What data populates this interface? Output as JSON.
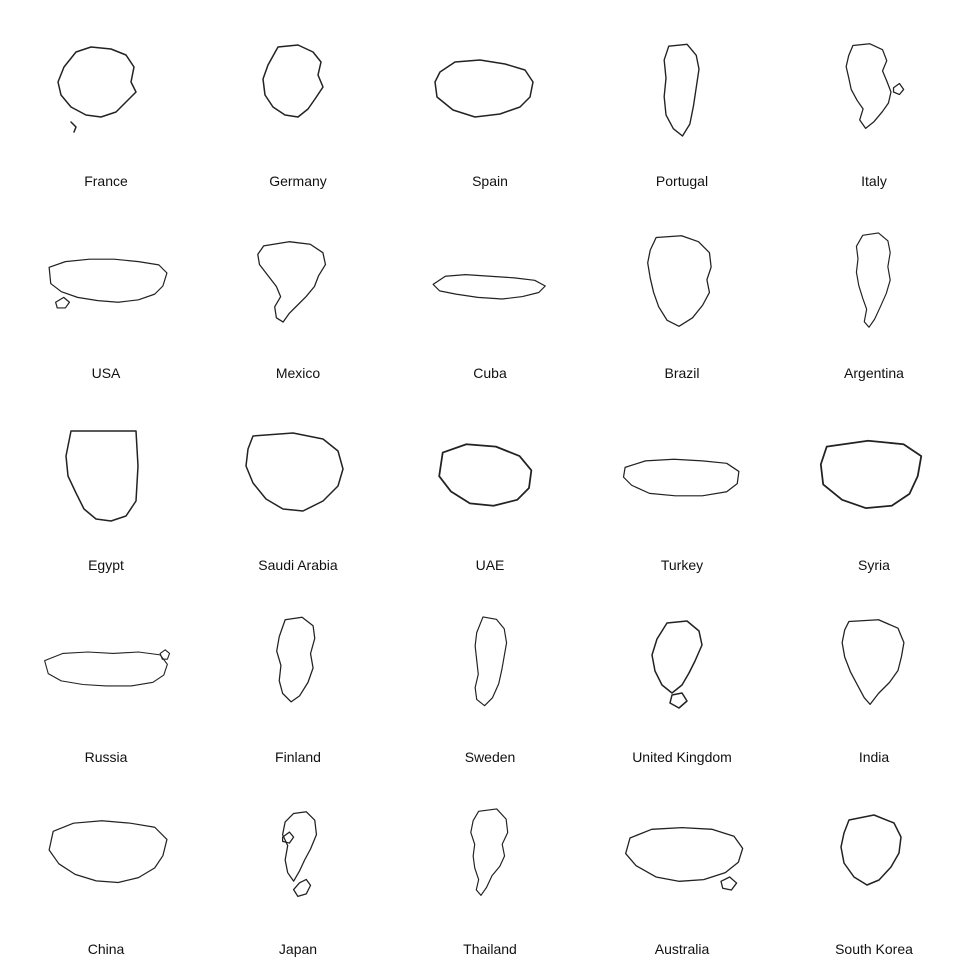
{
  "countries": [
    {
      "name": "France",
      "row": 1,
      "col": 1
    },
    {
      "name": "Germany",
      "row": 1,
      "col": 2
    },
    {
      "name": "Spain",
      "row": 1,
      "col": 3
    },
    {
      "name": "Portugal",
      "row": 1,
      "col": 4
    },
    {
      "name": "Italy",
      "row": 1,
      "col": 5
    },
    {
      "name": "USA",
      "row": 2,
      "col": 1
    },
    {
      "name": "Mexico",
      "row": 2,
      "col": 2
    },
    {
      "name": "Cuba",
      "row": 2,
      "col": 3
    },
    {
      "name": "Brazil",
      "row": 2,
      "col": 4
    },
    {
      "name": "Argentina",
      "row": 2,
      "col": 5
    },
    {
      "name": "Egypt",
      "row": 3,
      "col": 1
    },
    {
      "name": "Saudi Arabia",
      "row": 3,
      "col": 2
    },
    {
      "name": "UAE",
      "row": 3,
      "col": 3
    },
    {
      "name": "Turkey",
      "row": 3,
      "col": 4
    },
    {
      "name": "Syria",
      "row": 3,
      "col": 5
    },
    {
      "name": "Russia",
      "row": 4,
      "col": 1
    },
    {
      "name": "Finland",
      "row": 4,
      "col": 2
    },
    {
      "name": "Sweden",
      "row": 4,
      "col": 3
    },
    {
      "name": "United Kingdom",
      "row": 4,
      "col": 4
    },
    {
      "name": "India",
      "row": 4,
      "col": 5
    },
    {
      "name": "China",
      "row": 5,
      "col": 1
    },
    {
      "name": "Japan",
      "row": 5,
      "col": 2
    },
    {
      "name": "Thailand",
      "row": 5,
      "col": 3
    },
    {
      "name": "Australia",
      "row": 5,
      "col": 4
    },
    {
      "name": "South Korea",
      "row": 5,
      "col": 5
    }
  ]
}
